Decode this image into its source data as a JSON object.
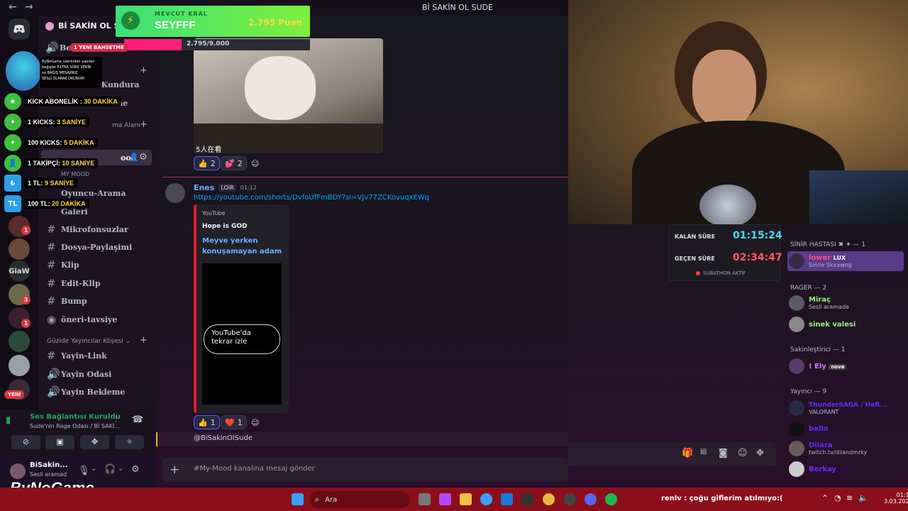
{
  "window": {
    "title": "Bİ SAKİN OL SUDE",
    "nav_back": "←",
    "nav_forward": "→"
  },
  "server": {
    "name": "Bİ SAKİN OL SU...",
    "new_mentions_badge": "1 YENİ BAHSETME",
    "new_badge": "YENİ",
    "giaw_label": "GiaW"
  },
  "channels": {
    "partial1": "Be...",
    "partial2": "-Kundura",
    "partial3": "ane",
    "partial4": "ma Alanı",
    "partial5": "ood",
    "partial5_sub": "MY MOOD",
    "partial6": "Oyuncu-Arama",
    "partial7": "Galeri",
    "items": [
      "Mikrofonsuzlar",
      "Dosya-Paylaşimi",
      "Klip",
      "Edit-Klip",
      "Bump",
      "öneri-tavsiye"
    ],
    "category": "Güzide Yayıncılar Köşesi",
    "items2": [
      "Yayin-Link",
      "Yayin Odasi",
      "Yayin Bekleme"
    ]
  },
  "voice": {
    "status": "Ses Bağlantısı Kuruldu",
    "channel": "Sude'nin Rage Odası / Bİ SAKİ..."
  },
  "user": {
    "name": "BiSakin...",
    "status": "Sesli aramad"
  },
  "overlay": {
    "goal_label": "MEVCUT KRAL",
    "goal_name": "SEYFFF",
    "goal_points": "2.795 Puan",
    "goal_progress": "2.795/9.000",
    "goal_fraction": 0.31,
    "info": [
      "ByNoGame üzerinden yapılan",
      "bağışlar EXTRA SÜRE VERİR",
      "ve BAĞIŞ MESAJINIZ",
      "SESLİ OLARAK OKUNUR!"
    ],
    "rows": [
      {
        "label": "KICK ABONELİK :",
        "value": "30 DAKİKA",
        "color": "#53fc18"
      },
      {
        "label": "1 KICKS:",
        "value": "3 SANİYE",
        "color": "#53fc18"
      },
      {
        "label": "100 KICKS:",
        "value": "5 DAKİKA",
        "color": "#53fc18"
      },
      {
        "label": "1 TAKİPÇİ:",
        "value": "10 SANİYE",
        "color": "#53fc18"
      },
      {
        "label": "1 TL:",
        "value": "9 SANİYE",
        "color": "#2ba0e8"
      },
      {
        "label": "100 TL:",
        "value": "20 DAKİKA",
        "color": "#2ba0e8"
      }
    ],
    "logo": "ByNoGame"
  },
  "messages": {
    "cat_caption": "5人在看",
    "cat_reactions": [
      {
        "emoji": "👍",
        "count": "2"
      },
      {
        "emoji": "💕",
        "count": "2"
      }
    ],
    "author": "Enes",
    "author_tag": "LOIR",
    "time": "01:12",
    "link": "https://youtube.com/shorts/DvfoUfFmBDY?si=VJv77ZCKovuqxEWq",
    "embed_provider": "YouTube",
    "embed_author": "Hope is GOD",
    "embed_title": "Meyve yerken konuşamayan adam",
    "embed_button": "YouTube'da tekrar izle",
    "embed_reactions": [
      {
        "emoji": "👍",
        "count": "1"
      },
      {
        "emoji": "❤️",
        "count": "1"
      }
    ],
    "mention": "@BiSakinOlSude"
  },
  "composer": {
    "placeholder": "#My-Mood kanalına mesaj gönder"
  },
  "subathon": {
    "remaining_label": "KALAN SÜRE",
    "remaining": "01:15:24",
    "elapsed_label": "GEÇEN SÜRE",
    "elapsed": "02:34:47",
    "status": "SUBATHON AKTİF"
  },
  "members": {
    "groups": [
      {
        "title": "SİNİR HASTASI ✖ ✦ — 1"
      },
      {
        "title": "RAGER — 2"
      },
      {
        "title": "Sakinleştirici — 1"
      },
      {
        "title": "Yayıncı — 9"
      }
    ],
    "lower": {
      "name": "lower",
      "tag": "LUX",
      "sub": "Smile Skxawng"
    },
    "mirac": {
      "name": "Miraç",
      "sub": "Sesli aramada"
    },
    "sinek": {
      "name": "sinek valesi"
    },
    "ely": {
      "name": "! Ely",
      "tag": "nova"
    },
    "yayinci1": {
      "name": "ThunderSAGA / HaR...",
      "sub": "VALORANT"
    },
    "yayinci2": {
      "name": "bello"
    },
    "yayinci3": {
      "name": "Dilara",
      "sub": "twitch.tv/dilandmrky"
    },
    "yayinci4": {
      "name": "Berkay"
    }
  },
  "taskbar": {
    "search": "Ara",
    "ticker": "renlv : çoğu giflerim atılmıyo:(",
    "time": "01:13",
    "date": "3.03.2026"
  }
}
